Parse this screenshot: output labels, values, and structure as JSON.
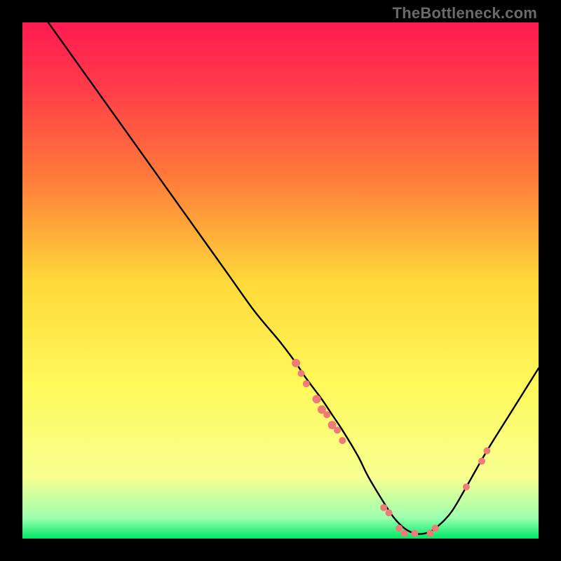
{
  "watermark": "TheBottleneck.com",
  "chart_data": {
    "type": "line",
    "title": "",
    "xlabel": "",
    "ylabel": "",
    "xlim": [
      0,
      100
    ],
    "ylim": [
      0,
      100
    ],
    "grid": false,
    "legend": false,
    "gradient_stops": [
      {
        "offset": 0,
        "color": "#ff1a52"
      },
      {
        "offset": 12,
        "color": "#ff3a4a"
      },
      {
        "offset": 30,
        "color": "#ff7a3a"
      },
      {
        "offset": 50,
        "color": "#ffd83a"
      },
      {
        "offset": 70,
        "color": "#fff95a"
      },
      {
        "offset": 88,
        "color": "#f8ff90"
      },
      {
        "offset": 96,
        "color": "#9dffb0"
      },
      {
        "offset": 100,
        "color": "#00e867"
      }
    ],
    "series": [
      {
        "name": "bottleneck-curve",
        "x": [
          5,
          10,
          15,
          20,
          25,
          30,
          35,
          40,
          45,
          50,
          53,
          55,
          58,
          60,
          62,
          65,
          67,
          70,
          72,
          74,
          76,
          78,
          80,
          83,
          86,
          90,
          95,
          100
        ],
        "y": [
          100,
          93,
          86,
          79,
          72,
          65,
          58,
          51,
          44,
          38,
          34,
          31,
          27,
          24,
          21,
          16,
          12,
          7,
          4,
          2,
          1,
          1,
          2,
          5,
          10,
          17,
          25,
          33
        ]
      }
    ],
    "markers": [
      {
        "x": 53,
        "y": 34,
        "r": 6
      },
      {
        "x": 54,
        "y": 32,
        "r": 5
      },
      {
        "x": 55,
        "y": 30,
        "r": 5
      },
      {
        "x": 57,
        "y": 27,
        "r": 6
      },
      {
        "x": 58,
        "y": 25,
        "r": 6
      },
      {
        "x": 59,
        "y": 24,
        "r": 5
      },
      {
        "x": 60,
        "y": 22,
        "r": 6
      },
      {
        "x": 61,
        "y": 21,
        "r": 5
      },
      {
        "x": 62,
        "y": 19,
        "r": 5
      },
      {
        "x": 70,
        "y": 6,
        "r": 5
      },
      {
        "x": 71,
        "y": 5,
        "r": 5
      },
      {
        "x": 73,
        "y": 2,
        "r": 5
      },
      {
        "x": 74,
        "y": 1,
        "r": 5
      },
      {
        "x": 76,
        "y": 1,
        "r": 5
      },
      {
        "x": 79,
        "y": 1,
        "r": 5
      },
      {
        "x": 80,
        "y": 2,
        "r": 5
      },
      {
        "x": 86,
        "y": 10,
        "r": 5
      },
      {
        "x": 89,
        "y": 15,
        "r": 5
      },
      {
        "x": 90,
        "y": 17,
        "r": 5
      }
    ],
    "marker_color": "#ef7b78"
  }
}
